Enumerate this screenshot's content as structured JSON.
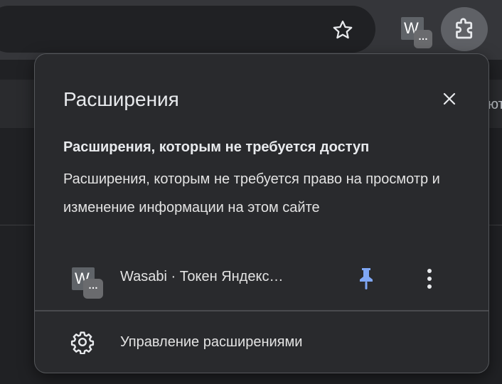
{
  "toolbar": {
    "extension_badge_letter": "W",
    "extension_badge_dots": "…"
  },
  "page": {
    "peek_text": "ют"
  },
  "popup": {
    "title": "Расширения",
    "section_heading": "Расширения, которым не требуется доступ",
    "section_description": "Расширения, которым не требуется право на просмотр и изменение информации на этом сайте",
    "extensions": [
      {
        "icon_letter": "W",
        "icon_dots": "…",
        "name": "Wasabi · Токен Яндекс…",
        "pinned": true
      }
    ],
    "manage_label": "Управление расширениями"
  },
  "colors": {
    "pin_accent": "#7fa7f5",
    "popup_bg": "#292a2d",
    "toolbar_bg": "#35363a"
  },
  "icons": [
    "star-icon",
    "puzzle-icon",
    "close-icon",
    "pin-icon",
    "more-vert-icon",
    "gear-icon"
  ]
}
